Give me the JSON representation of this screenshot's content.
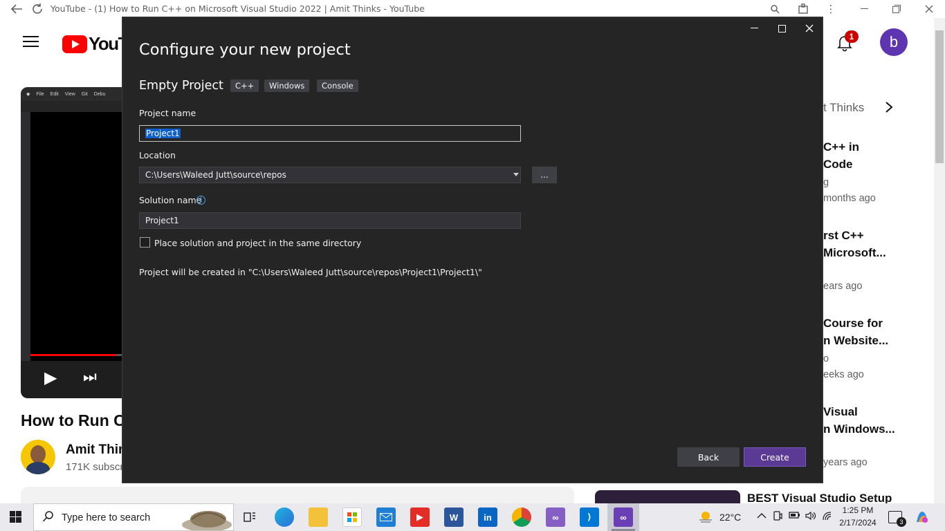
{
  "browser": {
    "title": "YouTube - (1) How to Run C++ on Microsoft Visual Studio 2022 | Amit Thinks - YouTube"
  },
  "youtube": {
    "logo_text": "YouTu",
    "notification_count": "1",
    "avatar_letter": "b",
    "player": {
      "menu_items": [
        "File",
        "Edit",
        "View",
        "Git",
        "Debu"
      ],
      "progress_percent": 94
    },
    "video_title": "How to Run C",
    "channel_name": "Amit Thin",
    "subscribers": "171K subscr",
    "recommendations": {
      "chip": "t Thinks",
      "items": [
        {
          "title_lines": [
            "C++ in",
            "Code"
          ],
          "meta_lines": [
            "g",
            "months ago"
          ]
        },
        {
          "title_lines": [
            "rst C++",
            "Microsoft..."
          ],
          "meta_lines": [
            "ears ago"
          ]
        },
        {
          "title_lines": [
            "Course for",
            "n Website..."
          ],
          "meta_lines": [
            "o",
            "eeks ago"
          ]
        },
        {
          "title_lines": [
            "Visual",
            "n Windows..."
          ],
          "meta_lines": [
            "years ago"
          ]
        }
      ],
      "bottom_title": "BEST Visual Studio Setup"
    }
  },
  "dialog": {
    "heading": "Configure your new project",
    "template_name": "Empty Project",
    "tags": [
      "C++",
      "Windows",
      "Console"
    ],
    "project_name_label": "Project name",
    "project_name_value": "Project1",
    "location_label": "Location",
    "location_value": "C:\\Users\\Waleed Jutt\\source\\repos",
    "browse_label": "...",
    "solution_name_label": "Solution name",
    "solution_name_value": "Project1",
    "same_directory_label": "Place solution and project in the same directory",
    "path_note": "Project will be created in \"C:\\Users\\Waleed Jutt\\source\\repos\\Project1\\Project1\\\"",
    "back_label": "Back",
    "create_label": "Create"
  },
  "taskbar": {
    "search_placeholder": "Type here to search",
    "weather": "22°C",
    "time": "1:25 PM",
    "date": "2/17/2024",
    "notification_count": "3"
  },
  "colors": {
    "dialog_bg": "#252526",
    "create_button": "#5b3a96",
    "youtube_red": "#ff0000",
    "avatar": "#5e35b1"
  }
}
